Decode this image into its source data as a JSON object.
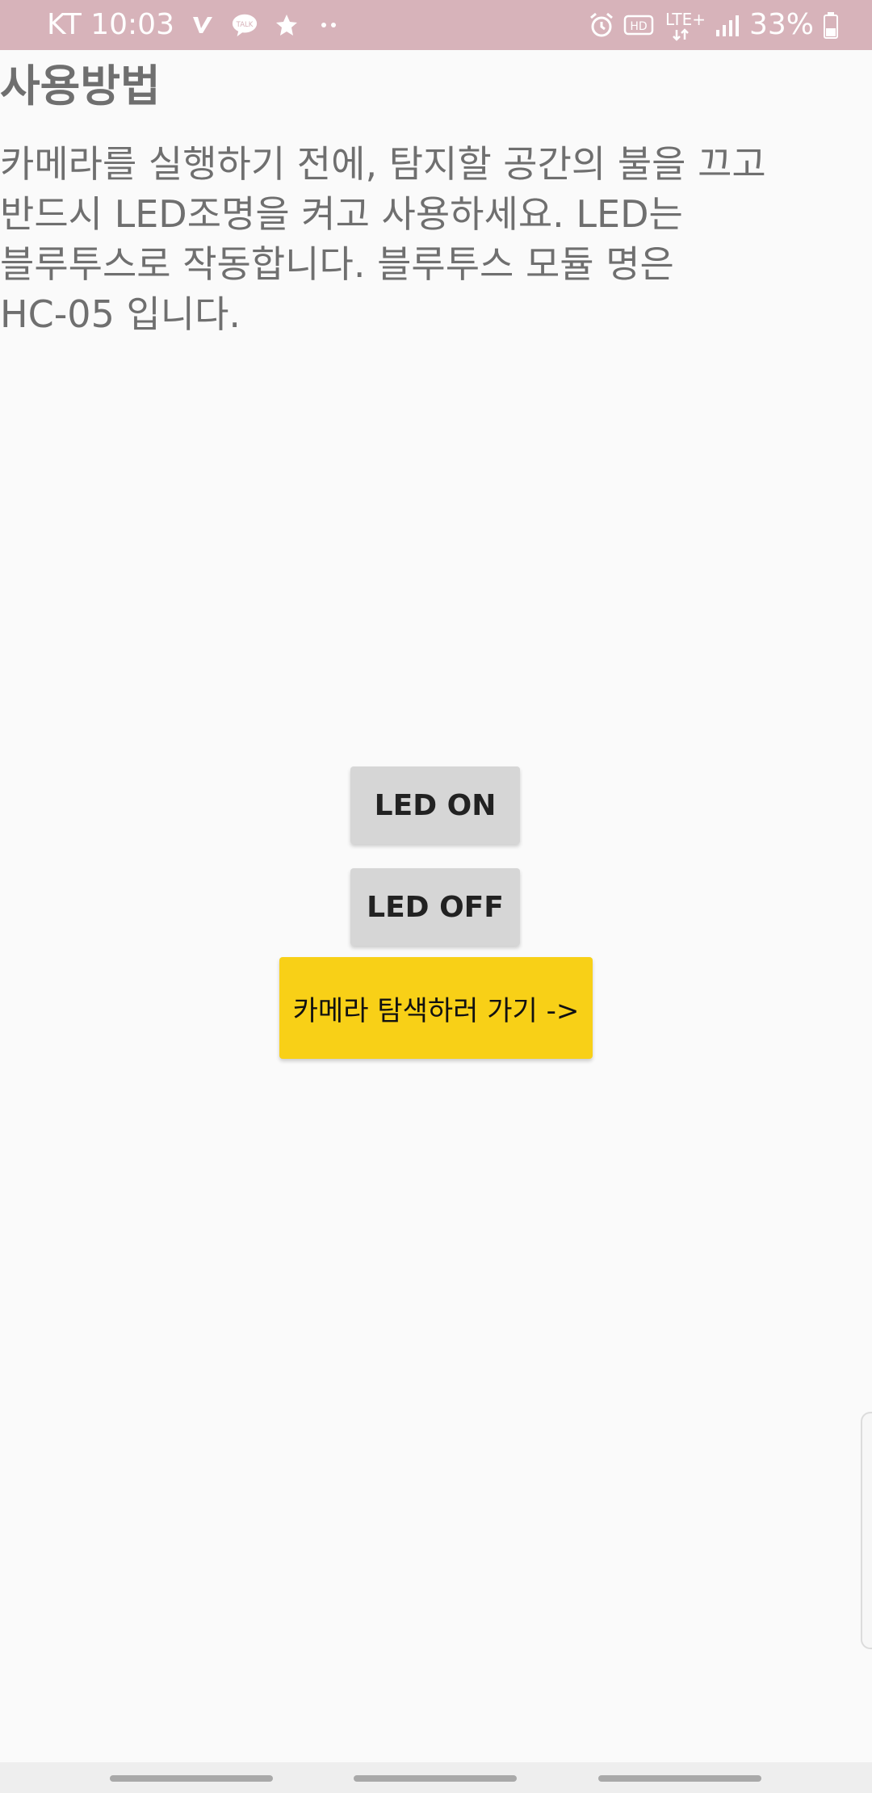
{
  "status_bar": {
    "carrier_time": "KT 10:03",
    "battery_percent": "33%",
    "network": "LTE+",
    "hd_label": "HD",
    "talk_label": "TALK",
    "colors": {
      "background": "#d7b3ba",
      "foreground": "#ffffff"
    }
  },
  "main": {
    "title": "사용방법",
    "description": "카메라를 실행하기 전에,  탐지할 공간의 불을 끄고\n반드시 LED조명을 켜고 사용하세요. LED는\n블루투스로 작동합니다. 블루투스 모듈 명은\nHC-05 입니다.",
    "buttons": {
      "led_on": "LED ON",
      "led_off": "LED OFF",
      "camera": "카메라 탐색하러 가기 ->"
    },
    "colors": {
      "gray_button": "#d6d6d6",
      "camera_button": "#f8d017",
      "text": "#6f6f6f"
    }
  }
}
